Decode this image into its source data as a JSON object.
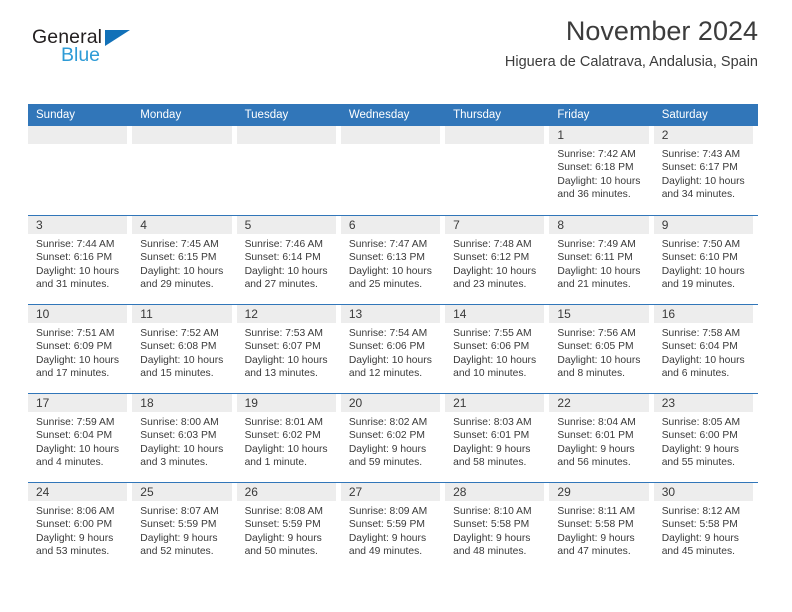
{
  "brand": {
    "name_part1": "General",
    "name_part2": "Blue",
    "triangle_color": "#1271b8",
    "blue_text_color": "#2e9bd6"
  },
  "header": {
    "title": "November 2024",
    "subtitle": "Higuera de Calatrava, Andalusia, Spain"
  },
  "theme": {
    "header_blue": "#3176b9",
    "day_strip_gray": "#ededed",
    "text_color": "#3a3a3a"
  },
  "weekdays": [
    "Sunday",
    "Monday",
    "Tuesday",
    "Wednesday",
    "Thursday",
    "Friday",
    "Saturday"
  ],
  "weeks": [
    [
      {
        "day": "",
        "sunrise": "",
        "sunset": "",
        "daylight_l1": "",
        "daylight_l2": ""
      },
      {
        "day": "",
        "sunrise": "",
        "sunset": "",
        "daylight_l1": "",
        "daylight_l2": ""
      },
      {
        "day": "",
        "sunrise": "",
        "sunset": "",
        "daylight_l1": "",
        "daylight_l2": ""
      },
      {
        "day": "",
        "sunrise": "",
        "sunset": "",
        "daylight_l1": "",
        "daylight_l2": ""
      },
      {
        "day": "",
        "sunrise": "",
        "sunset": "",
        "daylight_l1": "",
        "daylight_l2": ""
      },
      {
        "day": "1",
        "sunrise": "Sunrise: 7:42 AM",
        "sunset": "Sunset: 6:18 PM",
        "daylight_l1": "Daylight: 10 hours",
        "daylight_l2": "and 36 minutes."
      },
      {
        "day": "2",
        "sunrise": "Sunrise: 7:43 AM",
        "sunset": "Sunset: 6:17 PM",
        "daylight_l1": "Daylight: 10 hours",
        "daylight_l2": "and 34 minutes."
      }
    ],
    [
      {
        "day": "3",
        "sunrise": "Sunrise: 7:44 AM",
        "sunset": "Sunset: 6:16 PM",
        "daylight_l1": "Daylight: 10 hours",
        "daylight_l2": "and 31 minutes."
      },
      {
        "day": "4",
        "sunrise": "Sunrise: 7:45 AM",
        "sunset": "Sunset: 6:15 PM",
        "daylight_l1": "Daylight: 10 hours",
        "daylight_l2": "and 29 minutes."
      },
      {
        "day": "5",
        "sunrise": "Sunrise: 7:46 AM",
        "sunset": "Sunset: 6:14 PM",
        "daylight_l1": "Daylight: 10 hours",
        "daylight_l2": "and 27 minutes."
      },
      {
        "day": "6",
        "sunrise": "Sunrise: 7:47 AM",
        "sunset": "Sunset: 6:13 PM",
        "daylight_l1": "Daylight: 10 hours",
        "daylight_l2": "and 25 minutes."
      },
      {
        "day": "7",
        "sunrise": "Sunrise: 7:48 AM",
        "sunset": "Sunset: 6:12 PM",
        "daylight_l1": "Daylight: 10 hours",
        "daylight_l2": "and 23 minutes."
      },
      {
        "day": "8",
        "sunrise": "Sunrise: 7:49 AM",
        "sunset": "Sunset: 6:11 PM",
        "daylight_l1": "Daylight: 10 hours",
        "daylight_l2": "and 21 minutes."
      },
      {
        "day": "9",
        "sunrise": "Sunrise: 7:50 AM",
        "sunset": "Sunset: 6:10 PM",
        "daylight_l1": "Daylight: 10 hours",
        "daylight_l2": "and 19 minutes."
      }
    ],
    [
      {
        "day": "10",
        "sunrise": "Sunrise: 7:51 AM",
        "sunset": "Sunset: 6:09 PM",
        "daylight_l1": "Daylight: 10 hours",
        "daylight_l2": "and 17 minutes."
      },
      {
        "day": "11",
        "sunrise": "Sunrise: 7:52 AM",
        "sunset": "Sunset: 6:08 PM",
        "daylight_l1": "Daylight: 10 hours",
        "daylight_l2": "and 15 minutes."
      },
      {
        "day": "12",
        "sunrise": "Sunrise: 7:53 AM",
        "sunset": "Sunset: 6:07 PM",
        "daylight_l1": "Daylight: 10 hours",
        "daylight_l2": "and 13 minutes."
      },
      {
        "day": "13",
        "sunrise": "Sunrise: 7:54 AM",
        "sunset": "Sunset: 6:06 PM",
        "daylight_l1": "Daylight: 10 hours",
        "daylight_l2": "and 12 minutes."
      },
      {
        "day": "14",
        "sunrise": "Sunrise: 7:55 AM",
        "sunset": "Sunset: 6:06 PM",
        "daylight_l1": "Daylight: 10 hours",
        "daylight_l2": "and 10 minutes."
      },
      {
        "day": "15",
        "sunrise": "Sunrise: 7:56 AM",
        "sunset": "Sunset: 6:05 PM",
        "daylight_l1": "Daylight: 10 hours",
        "daylight_l2": "and 8 minutes."
      },
      {
        "day": "16",
        "sunrise": "Sunrise: 7:58 AM",
        "sunset": "Sunset: 6:04 PM",
        "daylight_l1": "Daylight: 10 hours",
        "daylight_l2": "and 6 minutes."
      }
    ],
    [
      {
        "day": "17",
        "sunrise": "Sunrise: 7:59 AM",
        "sunset": "Sunset: 6:04 PM",
        "daylight_l1": "Daylight: 10 hours",
        "daylight_l2": "and 4 minutes."
      },
      {
        "day": "18",
        "sunrise": "Sunrise: 8:00 AM",
        "sunset": "Sunset: 6:03 PM",
        "daylight_l1": "Daylight: 10 hours",
        "daylight_l2": "and 3 minutes."
      },
      {
        "day": "19",
        "sunrise": "Sunrise: 8:01 AM",
        "sunset": "Sunset: 6:02 PM",
        "daylight_l1": "Daylight: 10 hours",
        "daylight_l2": "and 1 minute."
      },
      {
        "day": "20",
        "sunrise": "Sunrise: 8:02 AM",
        "sunset": "Sunset: 6:02 PM",
        "daylight_l1": "Daylight: 9 hours",
        "daylight_l2": "and 59 minutes."
      },
      {
        "day": "21",
        "sunrise": "Sunrise: 8:03 AM",
        "sunset": "Sunset: 6:01 PM",
        "daylight_l1": "Daylight: 9 hours",
        "daylight_l2": "and 58 minutes."
      },
      {
        "day": "22",
        "sunrise": "Sunrise: 8:04 AM",
        "sunset": "Sunset: 6:01 PM",
        "daylight_l1": "Daylight: 9 hours",
        "daylight_l2": "and 56 minutes."
      },
      {
        "day": "23",
        "sunrise": "Sunrise: 8:05 AM",
        "sunset": "Sunset: 6:00 PM",
        "daylight_l1": "Daylight: 9 hours",
        "daylight_l2": "and 55 minutes."
      }
    ],
    [
      {
        "day": "24",
        "sunrise": "Sunrise: 8:06 AM",
        "sunset": "Sunset: 6:00 PM",
        "daylight_l1": "Daylight: 9 hours",
        "daylight_l2": "and 53 minutes."
      },
      {
        "day": "25",
        "sunrise": "Sunrise: 8:07 AM",
        "sunset": "Sunset: 5:59 PM",
        "daylight_l1": "Daylight: 9 hours",
        "daylight_l2": "and 52 minutes."
      },
      {
        "day": "26",
        "sunrise": "Sunrise: 8:08 AM",
        "sunset": "Sunset: 5:59 PM",
        "daylight_l1": "Daylight: 9 hours",
        "daylight_l2": "and 50 minutes."
      },
      {
        "day": "27",
        "sunrise": "Sunrise: 8:09 AM",
        "sunset": "Sunset: 5:59 PM",
        "daylight_l1": "Daylight: 9 hours",
        "daylight_l2": "and 49 minutes."
      },
      {
        "day": "28",
        "sunrise": "Sunrise: 8:10 AM",
        "sunset": "Sunset: 5:58 PM",
        "daylight_l1": "Daylight: 9 hours",
        "daylight_l2": "and 48 minutes."
      },
      {
        "day": "29",
        "sunrise": "Sunrise: 8:11 AM",
        "sunset": "Sunset: 5:58 PM",
        "daylight_l1": "Daylight: 9 hours",
        "daylight_l2": "and 47 minutes."
      },
      {
        "day": "30",
        "sunrise": "Sunrise: 8:12 AM",
        "sunset": "Sunset: 5:58 PM",
        "daylight_l1": "Daylight: 9 hours",
        "daylight_l2": "and 45 minutes."
      }
    ]
  ]
}
